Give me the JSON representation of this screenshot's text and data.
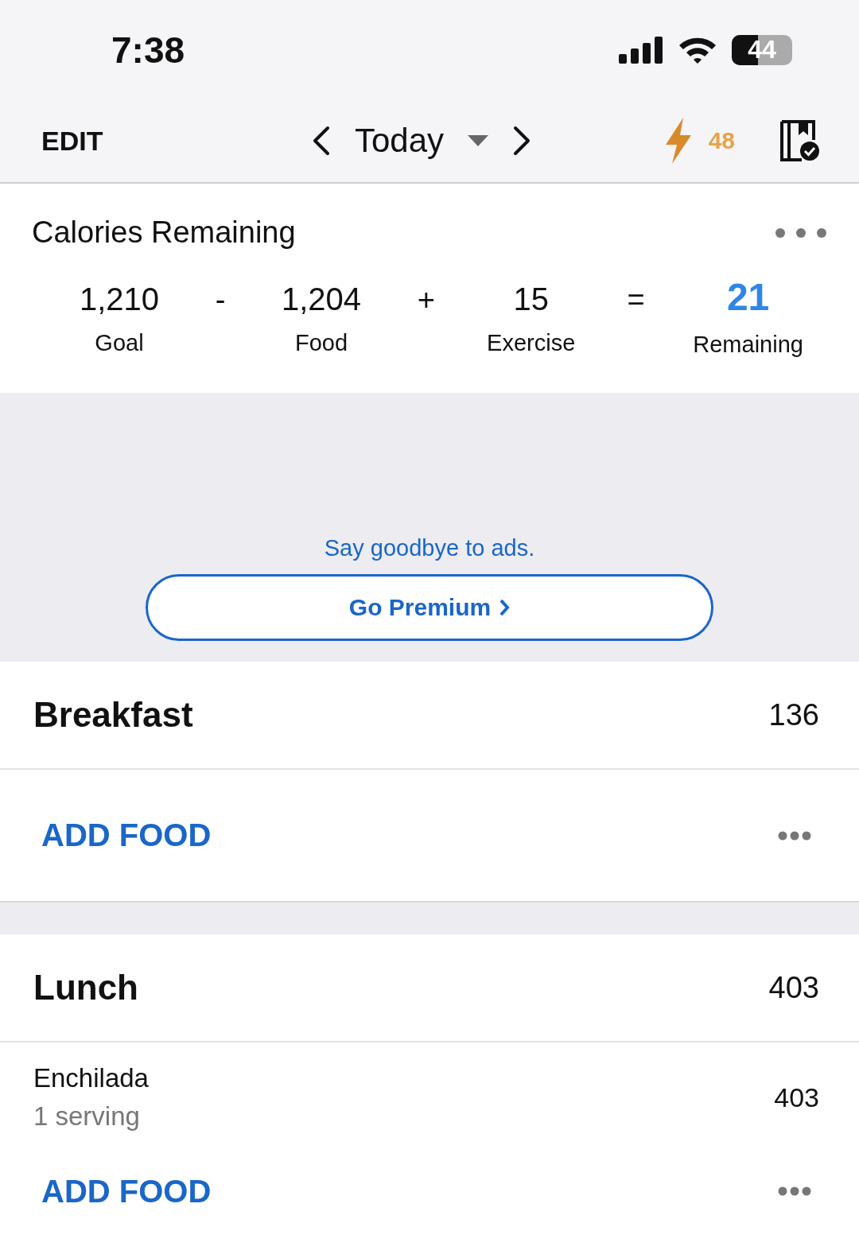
{
  "status_bar": {
    "time": "7:38",
    "battery": "44"
  },
  "nav": {
    "edit": "EDIT",
    "date": "Today",
    "streak": "48"
  },
  "calories": {
    "title": "Calories Remaining",
    "items": [
      {
        "kind": "term",
        "value": "1,210",
        "label": "Goal"
      },
      {
        "kind": "op",
        "symbol": "-"
      },
      {
        "kind": "term",
        "value": "1,204",
        "label": "Food"
      },
      {
        "kind": "op",
        "symbol": "+"
      },
      {
        "kind": "term",
        "value": "15",
        "label": "Exercise"
      },
      {
        "kind": "op",
        "symbol": "="
      },
      {
        "kind": "result",
        "value": "21",
        "label": "Remaining"
      }
    ]
  },
  "ad": {
    "text": "Say goodbye to ads.",
    "button": "Go Premium"
  },
  "meals": [
    {
      "name": "Breakfast",
      "calories": "136",
      "add_label": "ADD FOOD"
    },
    {
      "name": "Lunch",
      "calories": "403",
      "entries": [
        {
          "name": "Enchilada",
          "serving": "1 serving",
          "calories": "403"
        }
      ],
      "add_label": "ADD FOOD"
    }
  ]
}
